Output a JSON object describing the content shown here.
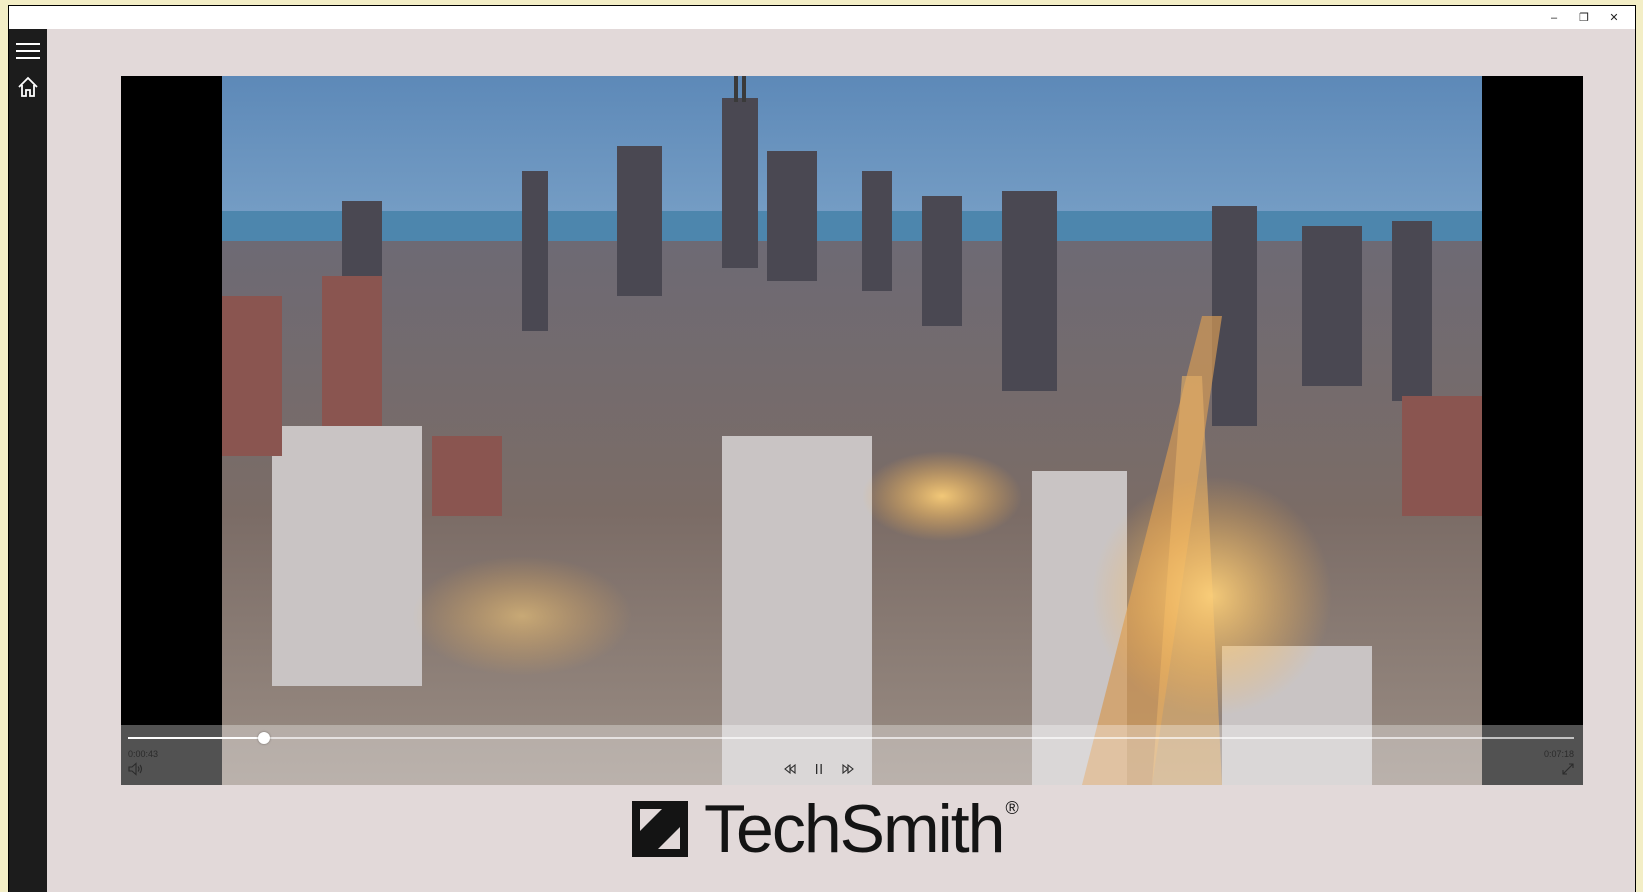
{
  "window": {
    "minimize_glyph": "–",
    "restore_glyph": "❐",
    "close_glyph": "✕"
  },
  "sidebar": {
    "items": [
      {
        "icon": "hamburger-menu-icon"
      },
      {
        "icon": "home-icon"
      }
    ]
  },
  "player": {
    "current_time": "0:00:43",
    "total_time": "0:07:18",
    "progress_fraction": 0.094,
    "icons": [
      "volume-icon",
      "rewind-icon",
      "pause-icon",
      "fast-forward-icon",
      "fullscreen-icon"
    ]
  },
  "brand": {
    "name": "TechSmith",
    "registered": "®",
    "logo": "techsmith-logo"
  },
  "colors": {
    "sidebar_bg": "#1c1c1c",
    "content_bg": "#e2d9d9",
    "outer_bg": "#f3eec6",
    "video_letterbox": "#000000"
  }
}
